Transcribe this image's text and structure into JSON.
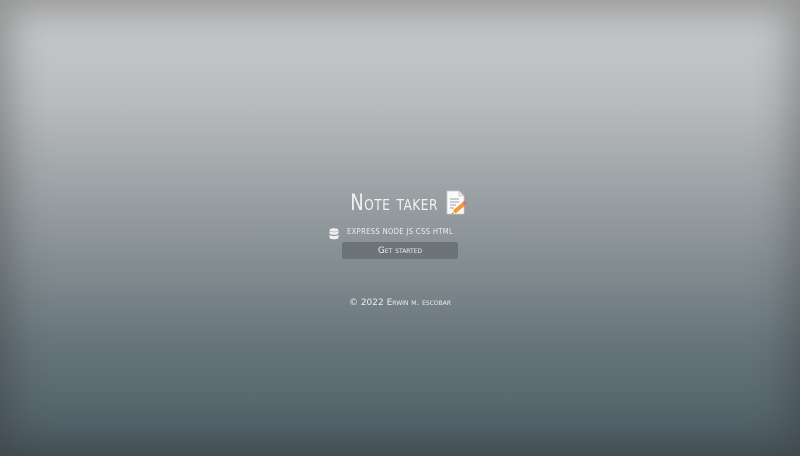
{
  "app": {
    "title": "Note taker",
    "title_icon": "memo-pencil-icon"
  },
  "tech": {
    "icon": "database-icon",
    "text": "express node js css html"
  },
  "cta": {
    "label": "Get started"
  },
  "footer": {
    "text": "© 2022 Erwin m. escobar"
  },
  "colors": {
    "background_top": "#cbcccd",
    "background_bottom": "#4c5b63",
    "button_bg": "#6d7479",
    "text": "#f1f1f1"
  }
}
